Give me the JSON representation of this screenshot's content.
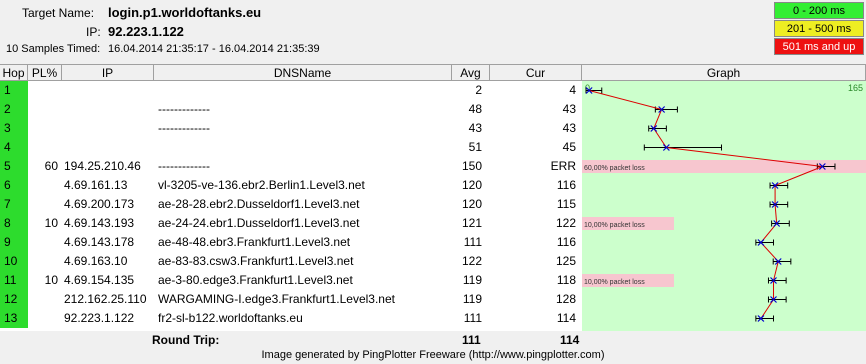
{
  "header": {
    "target_label": "Target Name:",
    "target_value": "login.p1.worldoftanks.eu",
    "ip_label": "IP:",
    "ip_value": "92.223.1.122",
    "samples_label": "10 Samples Timed:",
    "samples_value": "16.04.2014 21:35:17 - 16.04.2014 21:35:39"
  },
  "legend": [
    {
      "label": "0 - 200 ms",
      "color": "#33ee33"
    },
    {
      "label": "201 - 500 ms",
      "color": "#eeee22"
    },
    {
      "label": "501 ms and up",
      "color": "#ee1111"
    }
  ],
  "columns": {
    "hop": "Hop",
    "pl": "PL%",
    "ip": "IP",
    "dns": "DNSName",
    "avg": "Avg",
    "cur": "Cur",
    "graph": "Graph"
  },
  "graph": {
    "min_label": "0",
    "max_label": "165",
    "max_ms": 165
  },
  "rows": [
    {
      "hop": "1",
      "pl": "",
      "ip": "",
      "dns": "",
      "avg": "2",
      "cur": "4",
      "loss": ""
    },
    {
      "hop": "2",
      "pl": "",
      "ip": "",
      "dns": "-------------",
      "avg": "48",
      "cur": "43",
      "loss": ""
    },
    {
      "hop": "3",
      "pl": "",
      "ip": "",
      "dns": "-------------",
      "avg": "43",
      "cur": "43",
      "loss": ""
    },
    {
      "hop": "4",
      "pl": "",
      "ip": "",
      "dns": "",
      "avg": "51",
      "cur": "45",
      "loss": ""
    },
    {
      "hop": "5",
      "pl": "60",
      "ip": "194.25.210.46",
      "dns": "-------------",
      "avg": "150",
      "cur": "ERR",
      "loss": "60,00% packet loss"
    },
    {
      "hop": "6",
      "pl": "",
      "ip": "4.69.161.13",
      "dns": "vl-3205-ve-136.ebr2.Berlin1.Level3.net",
      "avg": "120",
      "cur": "116",
      "loss": ""
    },
    {
      "hop": "7",
      "pl": "",
      "ip": "4.69.200.173",
      "dns": "ae-28-28.ebr2.Dusseldorf1.Level3.net",
      "avg": "120",
      "cur": "115",
      "loss": ""
    },
    {
      "hop": "8",
      "pl": "10",
      "ip": "4.69.143.193",
      "dns": "ae-24-24.ebr1.Dusseldorf1.Level3.net",
      "avg": "121",
      "cur": "122",
      "loss": "10,00% packet loss"
    },
    {
      "hop": "9",
      "pl": "",
      "ip": "4.69.143.178",
      "dns": "ae-48-48.ebr3.Frankfurt1.Level3.net",
      "avg": "111",
      "cur": "116",
      "loss": ""
    },
    {
      "hop": "10",
      "pl": "",
      "ip": "4.69.163.10",
      "dns": "ae-83-83.csw3.Frankfurt1.Level3.net",
      "avg": "122",
      "cur": "125",
      "loss": ""
    },
    {
      "hop": "11",
      "pl": "10",
      "ip": "4.69.154.135",
      "dns": "ae-3-80.edge3.Frankfurt1.Level3.net",
      "avg": "119",
      "cur": "118",
      "loss": "10,00% packet loss"
    },
    {
      "hop": "12",
      "pl": "",
      "ip": "212.162.25.110",
      "dns": "WARGAMING-I.edge3.Frankfurt1.Level3.net",
      "avg": "119",
      "cur": "128",
      "loss": ""
    },
    {
      "hop": "13",
      "pl": "",
      "ip": "92.223.1.122",
      "dns": "fr2-sl-b122.worldoftanks.eu",
      "avg": "111",
      "cur": "114",
      "loss": ""
    }
  ],
  "chart_data": {
    "type": "line",
    "x": [
      "1",
      "2",
      "3",
      "4",
      "5",
      "6",
      "7",
      "8",
      "9",
      "10",
      "11",
      "12",
      "13"
    ],
    "series": [
      {
        "values": [
          2,
          48,
          43,
          51,
          150,
          120,
          120,
          121,
          111,
          122,
          119,
          119,
          111
        ]
      }
    ],
    "xlabel": "",
    "ylabel": "",
    "ylim": [
      0,
      165
    ],
    "orientation": "horizontal"
  },
  "footer": {
    "round_trip_label": "Round Trip:",
    "round_trip_avg": "111",
    "round_trip_cur": "114",
    "generated": "Image generated by PingPlotter Freeware (http://www.pingplotter.com)"
  }
}
